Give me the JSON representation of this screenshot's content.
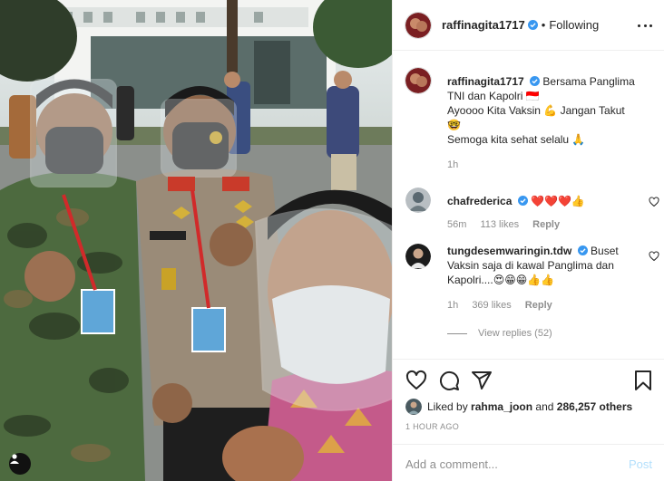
{
  "post": {
    "username": "raffinagita1717",
    "follow_state": "Following",
    "caption": {
      "line1": "Bersama Panglima",
      "line2": "TNI dan Kapolri 🇮🇩",
      "line3": "Ayoooo Kita Vaksin 💪 Jangan Takut",
      "line4": "🤓",
      "line5": "Semoga kita sehat selalu 🙏",
      "age": "1h"
    },
    "comments": [
      {
        "username": "chafrederica",
        "text": "❤️❤️❤️👍",
        "age": "56m",
        "likes": "113 likes",
        "reply": "Reply"
      },
      {
        "username": "tungdesemwaringin.tdw",
        "text1": "Buset",
        "text2": "Vaksin saja di kawal Panglima dan",
        "text3": "Kapolri....😍😁😁👍👍",
        "age": "1h",
        "likes": "369 likes",
        "reply": "Reply"
      }
    ],
    "view_replies": "View replies (52)",
    "liked_by": {
      "prefix": "Liked by",
      "user": "rahma_joon",
      "connector": "and",
      "others": "286,257 others"
    },
    "time_ago": "1 HOUR AGO",
    "comment_placeholder": "Add a comment...",
    "post_button": "Post"
  },
  "icons": {
    "verified_color": "#3897f0",
    "heart_color": "#262626"
  }
}
